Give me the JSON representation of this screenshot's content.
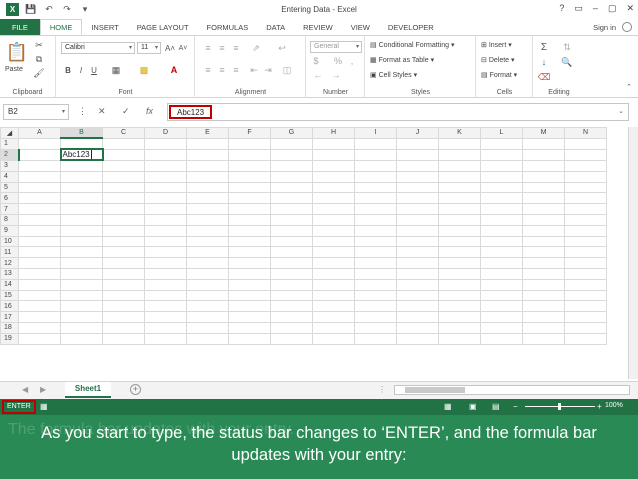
{
  "window": {
    "title": "Entering Data - Excel",
    "controls": [
      "?",
      "▭",
      "–",
      "▢",
      "✕"
    ]
  },
  "ribbon_tabs": [
    "FILE",
    "HOME",
    "INSERT",
    "PAGE LAYOUT",
    "FORMULAS",
    "DATA",
    "REVIEW",
    "VIEW",
    "DEVELOPER"
  ],
  "active_tab": "HOME",
  "signin_label": "Sign in",
  "ribbon": {
    "clipboard": {
      "label": "Clipboard",
      "paste_label": "Paste"
    },
    "font": {
      "label": "Font",
      "font_name": "Calibri",
      "font_size": "11",
      "grow": "A˄",
      "shrink": "A˅",
      "bold": "B",
      "italic": "I",
      "underline": "U"
    },
    "alignment": {
      "label": "Alignment"
    },
    "number": {
      "label": "Number",
      "format": "General",
      "currency": "$",
      "percent": "%",
      "comma": ","
    },
    "styles": {
      "label": "Styles",
      "conditional": "Conditional Formatting",
      "format_table": "Format as Table",
      "cell_styles": "Cell Styles"
    },
    "cells": {
      "label": "Cells",
      "insert": "Insert",
      "delete": "Delete",
      "format": "Format"
    },
    "editing": {
      "label": "Editing"
    }
  },
  "formula_bar": {
    "name_box": "B2",
    "cancel": "✕",
    "enter": "✓",
    "fx": "fx",
    "content": "Abc123"
  },
  "grid": {
    "columns": [
      "A",
      "B",
      "C",
      "D",
      "E",
      "F",
      "G",
      "H",
      "I",
      "J",
      "K",
      "L",
      "M",
      "N"
    ],
    "rows": [
      "1",
      "2",
      "3",
      "4",
      "5",
      "6",
      "7",
      "8",
      "9",
      "10",
      "11",
      "12",
      "13",
      "14",
      "15",
      "16",
      "17",
      "18",
      "19"
    ],
    "active_cell": {
      "row": 2,
      "col": "B",
      "value": "Abc123"
    }
  },
  "sheets": {
    "tabs": [
      "Sheet1"
    ],
    "add": "+"
  },
  "status": {
    "mode": "ENTER",
    "zoom": "100%"
  },
  "caption": {
    "text": "As you start to type, the status bar changes to ‘ENTER’, and the formula bar updates with your entry:",
    "ghost_text": "The formula bar updates with your entry."
  },
  "colors": {
    "excel_green": "#217346",
    "highlight_red": "#c00000",
    "caption_bg": "#2a8a55"
  }
}
